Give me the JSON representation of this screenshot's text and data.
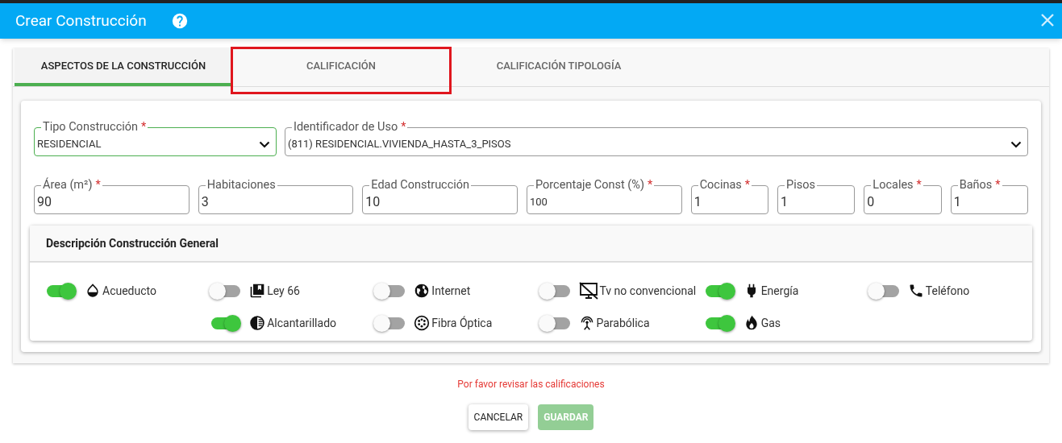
{
  "dialog": {
    "title": "Crear Construcción"
  },
  "tabs": [
    {
      "label": "ASPECTOS DE LA CONSTRUCCIÓN",
      "selected": true,
      "highlighted": false
    },
    {
      "label": "CALIFICACIÓN",
      "selected": false,
      "highlighted": true
    },
    {
      "label": "CALIFICACIÓN TIPOLOGÍA",
      "selected": false,
      "highlighted": false
    }
  ],
  "fields_row_1": [
    {
      "kind": "select",
      "label": "Tipo Construcción",
      "mark": "*",
      "value": "RESIDENCIAL",
      "focused": true
    },
    {
      "kind": "select",
      "label": "Identificador de Uso",
      "mark": "*",
      "value": "(811) RESIDENCIAL.VIVIENDA_HASTA_3_PISOS",
      "focused": false
    }
  ],
  "fields_row_2": [
    {
      "label": "Área (m²)",
      "mark": "*",
      "value": "90",
      "focused": false
    },
    {
      "label": "Habitaciones",
      "value": "3",
      "focused": false
    },
    {
      "label": "Edad Construcción",
      "value": "10",
      "focused": false
    },
    {
      "label": "Porcentaje Const (%)",
      "mark": "*",
      "value": "100",
      "focused": false
    },
    {
      "label": "Cocinas",
      "mark": "*",
      "value": "1",
      "focused": false
    },
    {
      "label": "Pisos",
      "value": "1",
      "focused": false
    },
    {
      "label": "Locales",
      "mark": "*",
      "value": "0",
      "focused": false
    },
    {
      "label": "Baños",
      "mark": "*",
      "value": "1",
      "focused": false
    }
  ],
  "services": {
    "title": "Descripción Construcción General",
    "columns": [
      [
        {
          "label": "Acueducto",
          "on": true
        }
      ],
      [
        {
          "label": "Ley 66",
          "on": false
        },
        {
          "label": "Alcantarillado",
          "on": true
        }
      ],
      [
        {
          "label": "Internet",
          "on": false
        },
        {
          "label": "Fibra Óptica",
          "on": false
        }
      ],
      [
        {
          "label": "Tv no convencional",
          "on": false
        },
        {
          "label": "Parabólica",
          "on": false
        }
      ],
      [
        {
          "label": "Energía",
          "on": true
        },
        {
          "label": "Gas",
          "on": true
        }
      ],
      [
        {
          "label": "Teléfono",
          "on": false
        }
      ]
    ]
  },
  "error_message": "Por favor revisar las calificaciones",
  "buttons": [
    {
      "kind": "cancel",
      "label": "CANCELAR",
      "disabled": false
    },
    {
      "kind": "save",
      "label": "GUARDAR",
      "disabled": true
    }
  ]
}
